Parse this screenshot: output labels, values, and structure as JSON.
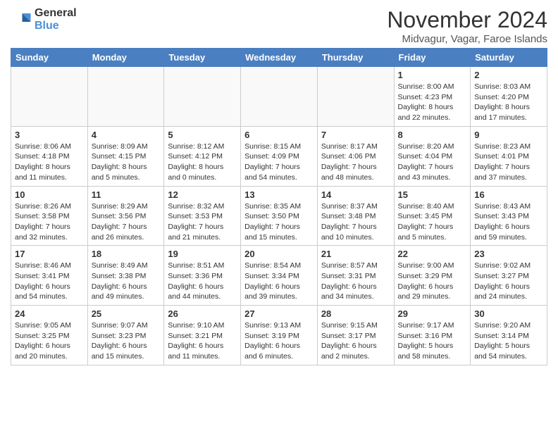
{
  "logo": {
    "general": "General",
    "blue": "Blue"
  },
  "title": "November 2024",
  "location": "Midvagur, Vagar, Faroe Islands",
  "headers": [
    "Sunday",
    "Monday",
    "Tuesday",
    "Wednesday",
    "Thursday",
    "Friday",
    "Saturday"
  ],
  "weeks": [
    [
      {
        "day": "",
        "info": ""
      },
      {
        "day": "",
        "info": ""
      },
      {
        "day": "",
        "info": ""
      },
      {
        "day": "",
        "info": ""
      },
      {
        "day": "",
        "info": ""
      },
      {
        "day": "1",
        "info": "Sunrise: 8:00 AM\nSunset: 4:23 PM\nDaylight: 8 hours\nand 22 minutes."
      },
      {
        "day": "2",
        "info": "Sunrise: 8:03 AM\nSunset: 4:20 PM\nDaylight: 8 hours\nand 17 minutes."
      }
    ],
    [
      {
        "day": "3",
        "info": "Sunrise: 8:06 AM\nSunset: 4:18 PM\nDaylight: 8 hours\nand 11 minutes."
      },
      {
        "day": "4",
        "info": "Sunrise: 8:09 AM\nSunset: 4:15 PM\nDaylight: 8 hours\nand 5 minutes."
      },
      {
        "day": "5",
        "info": "Sunrise: 8:12 AM\nSunset: 4:12 PM\nDaylight: 8 hours\nand 0 minutes."
      },
      {
        "day": "6",
        "info": "Sunrise: 8:15 AM\nSunset: 4:09 PM\nDaylight: 7 hours\nand 54 minutes."
      },
      {
        "day": "7",
        "info": "Sunrise: 8:17 AM\nSunset: 4:06 PM\nDaylight: 7 hours\nand 48 minutes."
      },
      {
        "day": "8",
        "info": "Sunrise: 8:20 AM\nSunset: 4:04 PM\nDaylight: 7 hours\nand 43 minutes."
      },
      {
        "day": "9",
        "info": "Sunrise: 8:23 AM\nSunset: 4:01 PM\nDaylight: 7 hours\nand 37 minutes."
      }
    ],
    [
      {
        "day": "10",
        "info": "Sunrise: 8:26 AM\nSunset: 3:58 PM\nDaylight: 7 hours\nand 32 minutes."
      },
      {
        "day": "11",
        "info": "Sunrise: 8:29 AM\nSunset: 3:56 PM\nDaylight: 7 hours\nand 26 minutes."
      },
      {
        "day": "12",
        "info": "Sunrise: 8:32 AM\nSunset: 3:53 PM\nDaylight: 7 hours\nand 21 minutes."
      },
      {
        "day": "13",
        "info": "Sunrise: 8:35 AM\nSunset: 3:50 PM\nDaylight: 7 hours\nand 15 minutes."
      },
      {
        "day": "14",
        "info": "Sunrise: 8:37 AM\nSunset: 3:48 PM\nDaylight: 7 hours\nand 10 minutes."
      },
      {
        "day": "15",
        "info": "Sunrise: 8:40 AM\nSunset: 3:45 PM\nDaylight: 7 hours\nand 5 minutes."
      },
      {
        "day": "16",
        "info": "Sunrise: 8:43 AM\nSunset: 3:43 PM\nDaylight: 6 hours\nand 59 minutes."
      }
    ],
    [
      {
        "day": "17",
        "info": "Sunrise: 8:46 AM\nSunset: 3:41 PM\nDaylight: 6 hours\nand 54 minutes."
      },
      {
        "day": "18",
        "info": "Sunrise: 8:49 AM\nSunset: 3:38 PM\nDaylight: 6 hours\nand 49 minutes."
      },
      {
        "day": "19",
        "info": "Sunrise: 8:51 AM\nSunset: 3:36 PM\nDaylight: 6 hours\nand 44 minutes."
      },
      {
        "day": "20",
        "info": "Sunrise: 8:54 AM\nSunset: 3:34 PM\nDaylight: 6 hours\nand 39 minutes."
      },
      {
        "day": "21",
        "info": "Sunrise: 8:57 AM\nSunset: 3:31 PM\nDaylight: 6 hours\nand 34 minutes."
      },
      {
        "day": "22",
        "info": "Sunrise: 9:00 AM\nSunset: 3:29 PM\nDaylight: 6 hours\nand 29 minutes."
      },
      {
        "day": "23",
        "info": "Sunrise: 9:02 AM\nSunset: 3:27 PM\nDaylight: 6 hours\nand 24 minutes."
      }
    ],
    [
      {
        "day": "24",
        "info": "Sunrise: 9:05 AM\nSunset: 3:25 PM\nDaylight: 6 hours\nand 20 minutes."
      },
      {
        "day": "25",
        "info": "Sunrise: 9:07 AM\nSunset: 3:23 PM\nDaylight: 6 hours\nand 15 minutes."
      },
      {
        "day": "26",
        "info": "Sunrise: 9:10 AM\nSunset: 3:21 PM\nDaylight: 6 hours\nand 11 minutes."
      },
      {
        "day": "27",
        "info": "Sunrise: 9:13 AM\nSunset: 3:19 PM\nDaylight: 6 hours\nand 6 minutes."
      },
      {
        "day": "28",
        "info": "Sunrise: 9:15 AM\nSunset: 3:17 PM\nDaylight: 6 hours\nand 2 minutes."
      },
      {
        "day": "29",
        "info": "Sunrise: 9:17 AM\nSunset: 3:16 PM\nDaylight: 5 hours\nand 58 minutes."
      },
      {
        "day": "30",
        "info": "Sunrise: 9:20 AM\nSunset: 3:14 PM\nDaylight: 5 hours\nand 54 minutes."
      }
    ]
  ]
}
